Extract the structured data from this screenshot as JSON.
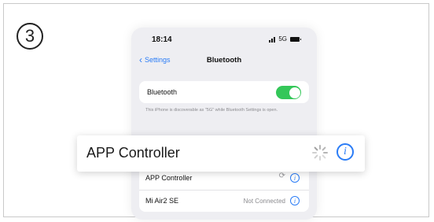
{
  "step": {
    "number": "3"
  },
  "status_bar": {
    "time": "18:14",
    "network": "5G"
  },
  "nav": {
    "back_label": "Settings",
    "title": "Bluetooth"
  },
  "bluetooth": {
    "label": "Bluetooth",
    "enabled": true,
    "note": "This iPhone is discoverable as \"5G\" while Bluetooth Settings is open."
  },
  "devices": [
    {
      "name": "APP Controller",
      "status": "",
      "connecting": true
    },
    {
      "name": "Mi Air2 SE",
      "status": "Not Connected",
      "connecting": false
    }
  ],
  "highlight": {
    "name": "APP Controller"
  },
  "colors": {
    "accent": "#2a7cf6",
    "toggle_on": "#34c759",
    "phone_bg": "#eeeef2"
  },
  "icons": {
    "info": "info-icon",
    "spinner": "loading-spinner-icon",
    "back": "chevron-left-icon"
  }
}
